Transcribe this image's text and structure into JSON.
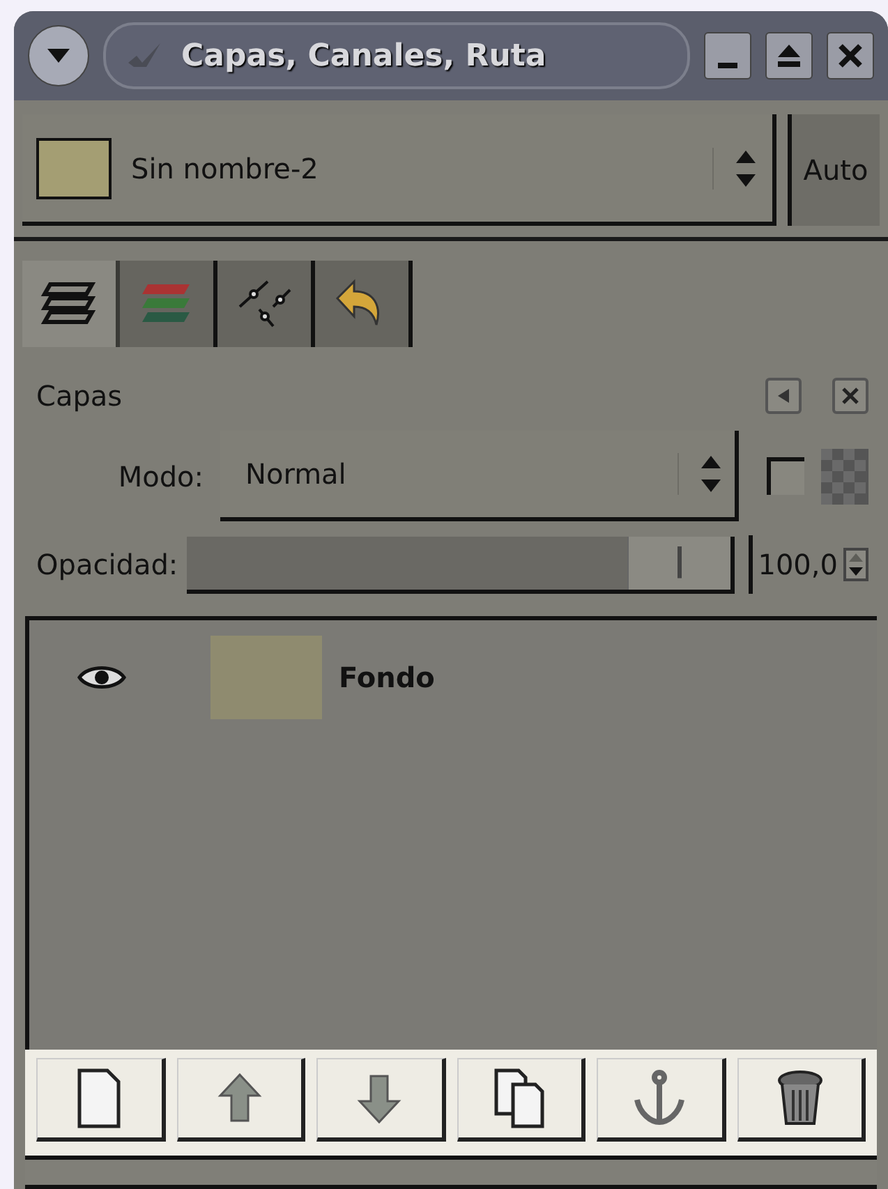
{
  "window": {
    "title": "Capas, Canales, Ruta"
  },
  "image_selector": {
    "name": "Sin nombre-2",
    "auto_button": "Auto"
  },
  "tabs": [
    {
      "kind": "layers",
      "selected": true
    },
    {
      "kind": "channels",
      "selected": false
    },
    {
      "kind": "paths",
      "selected": false
    },
    {
      "kind": "undo",
      "selected": false
    }
  ],
  "panel": {
    "title": "Capas"
  },
  "mode": {
    "label": "Modo:",
    "value": "Normal"
  },
  "lock_alpha": {
    "checked": false
  },
  "opacity": {
    "label": "Opacidad:",
    "level": 1.0,
    "value": "100,0"
  },
  "layers": [
    {
      "name": "Fondo",
      "visible": true,
      "selected": false
    }
  ],
  "buttons": [
    {
      "kind": "new"
    },
    {
      "kind": "raise"
    },
    {
      "kind": "lower"
    },
    {
      "kind": "duplicate"
    },
    {
      "kind": "anchor"
    },
    {
      "kind": "delete"
    }
  ]
}
